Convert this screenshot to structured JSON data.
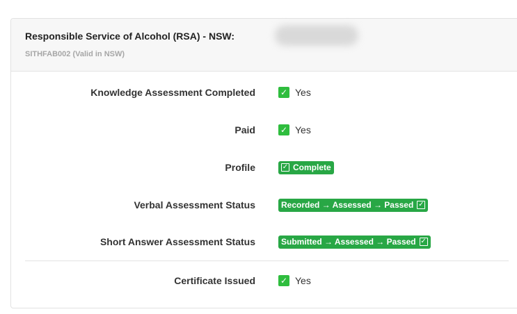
{
  "header": {
    "title": "Responsible Service of Alcohol (RSA) - NSW:",
    "subtitle": "SITHFAB002 (Valid in NSW)"
  },
  "rows": [
    {
      "label": "Knowledge Assessment Completed",
      "value": "Yes"
    },
    {
      "label": "Paid",
      "value": "Yes"
    },
    {
      "label": "Profile",
      "value": "Complete"
    },
    {
      "label": "Verbal Assessment Status",
      "value": "Recorded → Assessed → Passed"
    },
    {
      "label": "Short Answer Assessment Status",
      "value": "Submitted → Assessed → Passed"
    },
    {
      "label": "Certificate Issued",
      "value": "Yes"
    }
  ],
  "icons": {
    "check": "check-icon",
    "check_glyph": "✓"
  },
  "colors": {
    "check_green": "#2fbd3e",
    "badge_green": "#28a745",
    "header_bg": "#f7f7f7",
    "subtitle_gray": "#a6a6a6"
  }
}
